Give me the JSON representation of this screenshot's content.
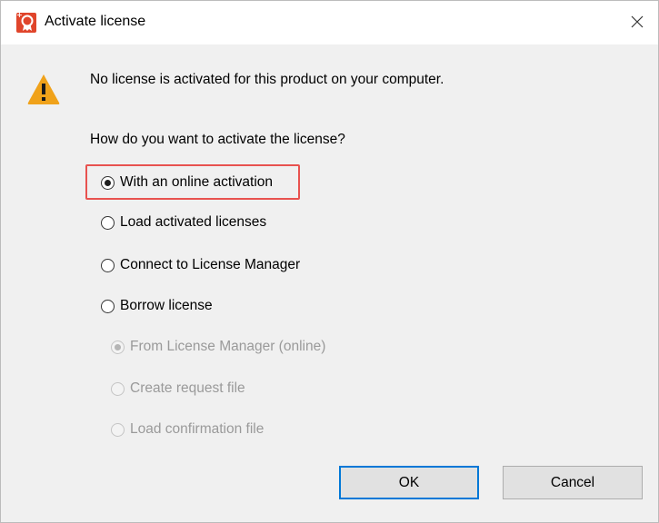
{
  "window": {
    "title": "Activate license",
    "close_icon": "close-icon"
  },
  "dialog": {
    "message": "No license is activated for this product on your computer.",
    "question": "How do you want to activate the license?"
  },
  "options": [
    {
      "label": "With an online activation",
      "selected": true,
      "enabled": true
    },
    {
      "label": "Load activated licenses",
      "selected": false,
      "enabled": true
    },
    {
      "label": "Connect to License Manager",
      "selected": false,
      "enabled": true
    },
    {
      "label": "Borrow license",
      "selected": false,
      "enabled": true
    }
  ],
  "borrow_options": [
    {
      "label": "From License Manager (online)",
      "selected": true,
      "enabled": false
    },
    {
      "label": "Create request file",
      "selected": false,
      "enabled": false
    },
    {
      "label": "Load confirmation file",
      "selected": false,
      "enabled": false
    }
  ],
  "buttons": {
    "ok": "OK",
    "cancel": "Cancel"
  },
  "colors": {
    "highlight": "#e8524f",
    "default_button_border": "#0078d7",
    "warning": "#f0a21a"
  }
}
